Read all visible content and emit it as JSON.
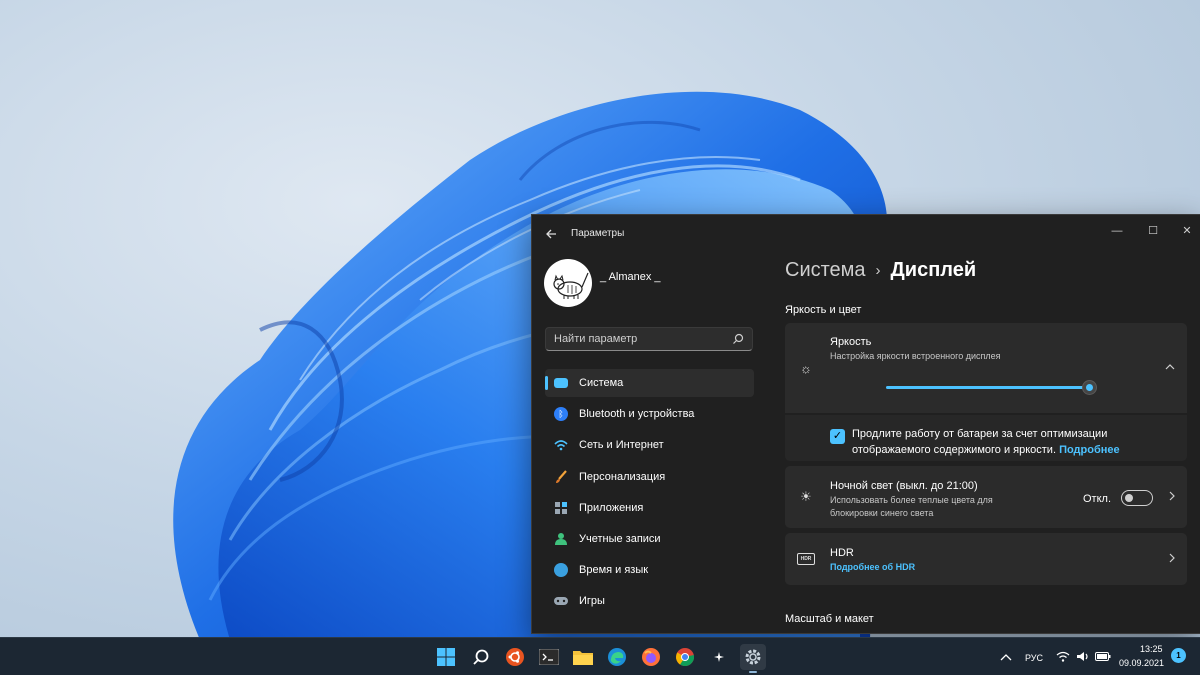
{
  "window": {
    "title": "Параметры",
    "minimize": "—",
    "maximize": "☐",
    "close": "✕"
  },
  "profile": {
    "name": "_ Almanex _"
  },
  "search": {
    "placeholder": "Найти параметр"
  },
  "sidebar": {
    "items": [
      {
        "label": "Система",
        "icon": "monitor-icon",
        "color": "#4cc2ff",
        "active": true
      },
      {
        "label": "Bluetooth и устройства",
        "icon": "bluetooth-icon",
        "color": "#2d7ff9"
      },
      {
        "label": "Сеть и Интернет",
        "icon": "wifi-icon",
        "color": "#4cc2ff"
      },
      {
        "label": "Персонализация",
        "icon": "brush-icon",
        "color": "#f2a33a"
      },
      {
        "label": "Приложения",
        "icon": "apps-icon",
        "color": "#9aa7b3"
      },
      {
        "label": "Учетные записи",
        "icon": "person-icon",
        "color": "#3fc27d"
      },
      {
        "label": "Время и язык",
        "icon": "globe-clock-icon",
        "color": "#3aa0e0"
      },
      {
        "label": "Игры",
        "icon": "gamepad-icon",
        "color": "#9aa7b3"
      }
    ]
  },
  "main": {
    "breadcrumb_parent": "Система",
    "breadcrumb_sep": "›",
    "breadcrumb_current": "Дисплей",
    "section_brightness": "Яркость и цвет",
    "brightness": {
      "title": "Яркость",
      "desc": "Настройка яркости встроенного дисплея",
      "value_percent": 100
    },
    "battery_saver": {
      "checked": true,
      "text": "Продлите работу от батареи за счет оптимизации отображаемого содержимого и яркости.",
      "link": "Подробнее"
    },
    "night_light": {
      "title": "Ночной свет (выкл. до 21:00)",
      "desc_line1": "Использовать более теплые цвета для",
      "desc_line2": "блокировки синего света",
      "toggle_label": "Откл.",
      "on": false
    },
    "hdr": {
      "title": "HDR",
      "link": "Подробнее об HDR",
      "badge": "HDR"
    },
    "section_scale": "Масштаб и макет"
  },
  "taskbar": {
    "apps": [
      "windows-start-icon",
      "search-icon",
      "ubuntu-icon",
      "terminal-icon",
      "file-explorer-icon",
      "edge-icon",
      "firefox-icon",
      "chrome-icon",
      "generic-app-icon",
      "settings-icon"
    ],
    "language": "РУС",
    "time": "13:25",
    "date": "09.09.2021",
    "notifications": "1"
  },
  "colors": {
    "accent": "#4cc2ff",
    "window_bg": "#202020",
    "card_bg": "#2b2b2b",
    "taskbar_bg": "#1c2733"
  }
}
